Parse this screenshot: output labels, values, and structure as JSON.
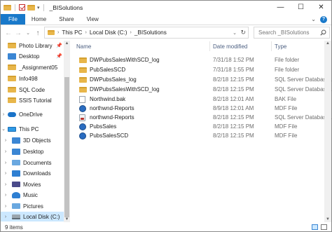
{
  "window": {
    "title": "_BISolutions",
    "minimize": "—",
    "maximize": "☐",
    "close": "✕"
  },
  "ribbon": {
    "tabs": [
      "File",
      "Home",
      "Share",
      "View"
    ],
    "expand": "⌄",
    "help": "?"
  },
  "nav": {
    "back": "←",
    "forward": "→",
    "recent": "⌄",
    "up": "↑"
  },
  "address": {
    "crumbs": [
      "This PC",
      "Local Disk (C:)",
      "_BISolutions"
    ],
    "separator": "›",
    "refresh": "↻",
    "dropdown": "⌄"
  },
  "search": {
    "placeholder": "Search _BISolutions"
  },
  "sidebar": {
    "items": [
      {
        "label": "Photo Library",
        "icon": "folder-icon",
        "pinned": true
      },
      {
        "label": "Desktop",
        "icon": "desktop-icon",
        "pinned": true
      },
      {
        "label": "_Assignment05",
        "icon": "folder-icon",
        "pinned": false
      },
      {
        "label": "Info498",
        "icon": "folder-icon",
        "pinned": false
      },
      {
        "label": "SQL Code",
        "icon": "folder-icon",
        "pinned": false
      },
      {
        "label": "SSIS Tutorial",
        "icon": "folder-icon",
        "pinned": false
      },
      {
        "label": "OneDrive",
        "icon": "cloud-icon",
        "pinned": false
      },
      {
        "label": "This PC",
        "icon": "pc-icon",
        "pinned": false
      },
      {
        "label": "3D Objects",
        "icon": "cube-icon",
        "pinned": false
      },
      {
        "label": "Desktop",
        "icon": "desktop-icon",
        "pinned": false
      },
      {
        "label": "Documents",
        "icon": "documents-icon",
        "pinned": false
      },
      {
        "label": "Downloads",
        "icon": "download-icon",
        "pinned": false
      },
      {
        "label": "Movies",
        "icon": "video-icon",
        "pinned": false
      },
      {
        "label": "Music",
        "icon": "music-icon",
        "pinned": false
      },
      {
        "label": "Pictures",
        "icon": "pictures-icon",
        "pinned": false
      },
      {
        "label": "Local Disk (C:)",
        "icon": "disk-icon",
        "pinned": false
      }
    ]
  },
  "columns": {
    "name": "Name",
    "date": "Date modified",
    "type": "Type"
  },
  "files": [
    {
      "name": "DWPubsSalesWithSCD_log",
      "date": "7/31/18 1:52 PM",
      "type": "File folder",
      "icon": "folder-icon"
    },
    {
      "name": "PubSalesSCD",
      "date": "7/31/18 1:55 PM",
      "type": "File folder",
      "icon": "folder-icon"
    },
    {
      "name": "DWPubsSales_log",
      "date": "8/2/18 12:15 PM",
      "type": "SQL Server Database...",
      "icon": "database-icon"
    },
    {
      "name": "DWPubsSalesWithSCD_log",
      "date": "8/2/18 12:15 PM",
      "type": "SQL Server Database...",
      "icon": "database-icon"
    },
    {
      "name": "Northwind.bak",
      "date": "8/2/18 12:01 AM",
      "type": "BAK File",
      "icon": "file-icon"
    },
    {
      "name": "northwnd-Reports",
      "date": "8/9/18 12:01 AM",
      "type": "MDF File",
      "icon": "mdf-icon"
    },
    {
      "name": "northwnd-Reports",
      "date": "8/2/18 12:15 PM",
      "type": "SQL Server Database...",
      "icon": "database-icon"
    },
    {
      "name": "PubsSales",
      "date": "8/2/18 12:15 PM",
      "type": "MDF File",
      "icon": "mdf-icon"
    },
    {
      "name": "PubsSalesSCD",
      "date": "8/2/18 12:15 PM",
      "type": "MDF File",
      "icon": "mdf-icon"
    }
  ],
  "status": {
    "count": "9 items"
  }
}
